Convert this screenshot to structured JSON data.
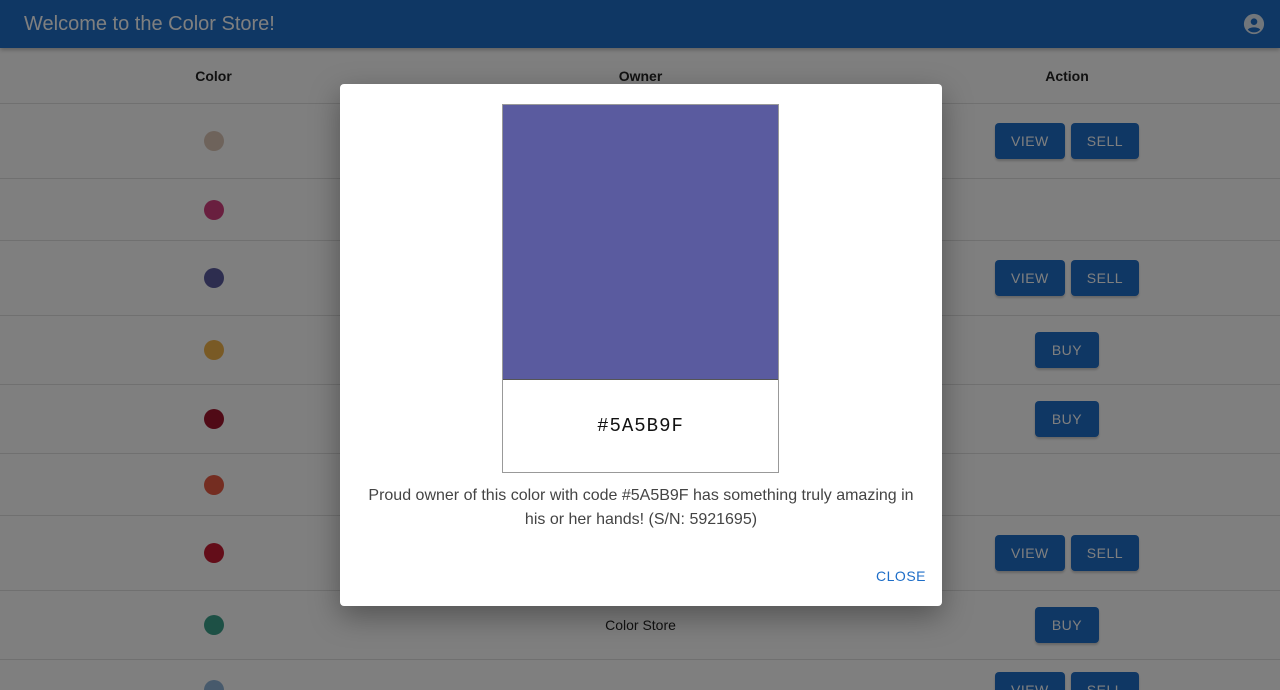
{
  "appbar": {
    "title": "Welcome to the Color Store!",
    "account_icon": "account-circle-icon"
  },
  "table": {
    "headers": {
      "color": "Color",
      "owner": "Owner",
      "action": "Action"
    },
    "rows": [
      {
        "swatch": "#dcc7b7",
        "owner": "",
        "actions": [
          "VIEW",
          "SELL"
        ]
      },
      {
        "swatch": "#d23f7e",
        "owner": "",
        "actions": []
      },
      {
        "swatch": "#5a5b9f",
        "owner": "",
        "actions": [
          "VIEW",
          "SELL"
        ]
      },
      {
        "swatch": "#f3b44a",
        "owner": "",
        "actions": [
          "BUY"
        ]
      },
      {
        "swatch": "#a0142c",
        "owner": "",
        "actions": [
          "BUY"
        ]
      },
      {
        "swatch": "#e85a42",
        "owner": "",
        "actions": []
      },
      {
        "swatch": "#c71a32",
        "owner": "",
        "actions": [
          "VIEW",
          "SELL"
        ]
      },
      {
        "swatch": "#3ba08a",
        "owner": "Color Store",
        "actions": [
          "BUY"
        ]
      },
      {
        "swatch": "#8fb4d8",
        "owner": "",
        "actions": [
          "VIEW",
          "SELL"
        ]
      }
    ]
  },
  "dialog": {
    "color_hex": "#5A5B9F",
    "code_label": "#5A5B9F",
    "description": "Proud owner of this color with code #5A5B9F has something truly amazing in his or her hands! (S/N: 5921695)",
    "close_label": "CLOSE"
  }
}
